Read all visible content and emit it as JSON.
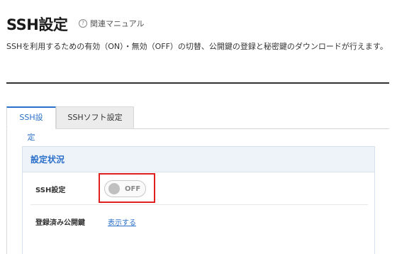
{
  "page": {
    "title": "SSH設定",
    "manual_link": "関連マニュアル",
    "description": "SSHを利用するための有効（ON）・無効（OFF）の切替、公開鍵の登録と秘密鍵のダウンロードが行えます。"
  },
  "tabs": [
    {
      "label": "SSH設定",
      "active": true
    },
    {
      "label": "SSHソフト設定",
      "active": false
    }
  ],
  "status_section": {
    "header": "設定状況",
    "rows": [
      {
        "label": "SSH設定",
        "toggle_state": "OFF"
      },
      {
        "label": "登録済み公開鍵",
        "link_text": "表示する"
      }
    ]
  },
  "colors": {
    "accent": "#2a6fc9",
    "highlight": "#e02020",
    "section_header_bg": "#eef3fa"
  }
}
